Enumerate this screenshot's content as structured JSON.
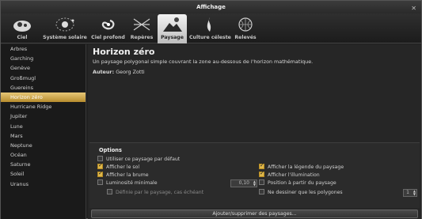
{
  "window": {
    "title": "Affichage"
  },
  "toolbar": {
    "tabs": [
      {
        "label": "Ciel",
        "icon": "sky-icon"
      },
      {
        "label": "Système solaire",
        "icon": "solar-system-icon"
      },
      {
        "label": "Ciel profond",
        "icon": "galaxy-icon"
      },
      {
        "label": "Repères",
        "icon": "markings-icon"
      },
      {
        "label": "Paysage",
        "icon": "landscape-icon",
        "active": true
      },
      {
        "label": "Culture céleste",
        "icon": "sky-culture-icon"
      },
      {
        "label": "Relevés",
        "icon": "surveys-icon"
      }
    ]
  },
  "sidebar": {
    "items": [
      "Arbres",
      "Garching",
      "Genève",
      "Großmugl",
      "Guereins",
      "Horizon zéro",
      "Hurricane Ridge",
      "Jupiter",
      "Lune",
      "Mars",
      "Neptune",
      "Océan",
      "Saturne",
      "Soleil",
      "Uranus"
    ],
    "selected": "Horizon zéro"
  },
  "landscape": {
    "title": "Horizon zéro",
    "description": "Un paysage polygonal simple couvrant la zone au-dessous de l'horizon mathématique.",
    "author_label": "Auteur:",
    "author": "Georg Zotti"
  },
  "options": {
    "title": "Options",
    "default_landscape": "Utiliser ce paysage par défaut",
    "show_ground": "Afficher le sol",
    "show_fog": "Afficher la brume",
    "min_brightness": "Luminosité minimale",
    "min_brightness_value": "0,10",
    "landscape_defined": "Définie par le paysage, cas échéant",
    "show_legend": "Afficher la légende du paysage",
    "show_illumination": "Afficher l'illumination",
    "position_from_landscape": "Position à partir du paysage",
    "polygons_only": "Ne dessiner que les polygones",
    "polygon_value": "1"
  },
  "buttons": {
    "add_remove": "Ajouter/supprimer des paysages..."
  },
  "colors": {
    "accent": "#c9a040",
    "background": "#262626"
  }
}
